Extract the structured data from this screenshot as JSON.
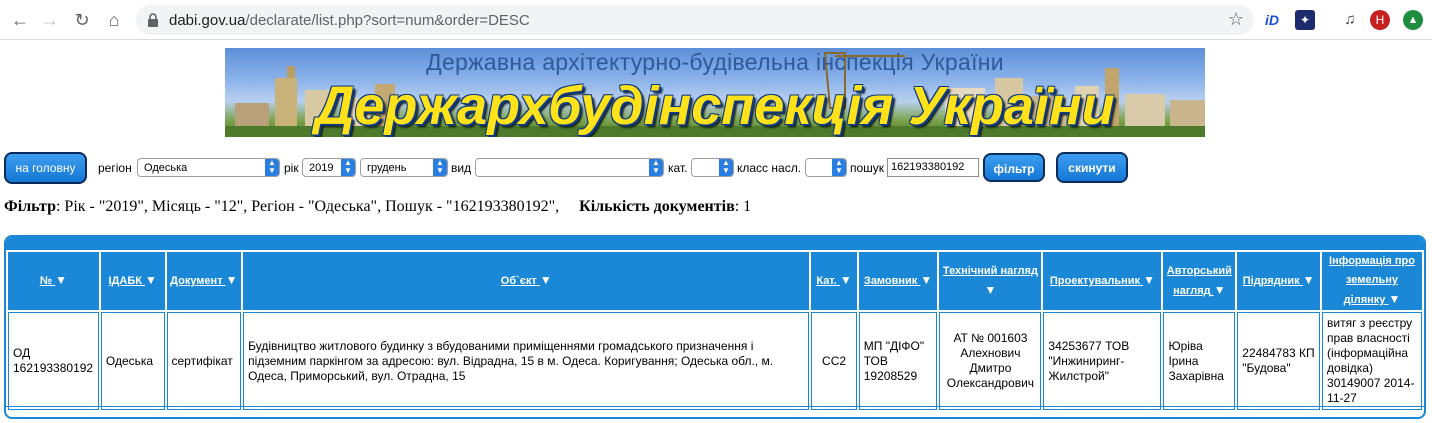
{
  "browser": {
    "url_host": "dabi.gov.ua",
    "url_path": "/declarate/list.php?sort=num&order=DESC",
    "avatar_letter": "Н",
    "ext_id_label": "iD"
  },
  "banner": {
    "subtitle": "Державна архітектурно-будівельна інспекція України",
    "title": "Держархбудінспекція України"
  },
  "filters": {
    "home_button": "на головну",
    "region_label": "регіон",
    "region_value": "Одеська",
    "year_label": "рік",
    "year_value": "2019",
    "month_value": "грудень",
    "type_label": "вид",
    "type_value": "",
    "cat_label": "кат.",
    "cat_value": "",
    "class_label": "класс насл.",
    "class_value": "",
    "search_label": "пошук",
    "search_value": "162193380192",
    "filter_button": "фільтр",
    "reset_button": "скинути"
  },
  "summary": {
    "filter_label": "Фільтр",
    "filter_text": ": Рік - \"2019\", Місяць - \"12\", Регіон - \"Одеська\", Пошук - \"162193380192\",",
    "count_label": "Кількість документів",
    "count_text": ": 1"
  },
  "table": {
    "headers": [
      "№",
      "ІДАБК",
      "Документ",
      "Об`єкт",
      "Кат.",
      "Замовник",
      "Технічний нагляд",
      "Проектувальник",
      "Авторський нагляд",
      "Підрядник",
      "Інформація про земельну ділянку"
    ],
    "rows": [
      {
        "num": "ОД 162193380192",
        "idabk": "Одеська",
        "document": "сертифікат",
        "object": "Будівництво житлового будинку з вбудованими приміщеннями громадського призначення і підземним паркінгом за адресою: вул. Відрадна, 15 в м. Одеса. Коригування; Одеська обл., м. Одеса, Приморський, вул. Отрадна, 15",
        "cat": "СС2",
        "customer": "МП \"ДІФО\" ТОВ 19208529",
        "tech_supervision": "АТ № 001603 Алехнович Дмитро Олександрович",
        "designer": "34253677 ТОВ \"Инжиниринг-Жилстрой\"",
        "author_supervision": "Юріва Ірина Захарівна",
        "contractor": "22484783 КП \"Будова\"",
        "land_info": "витяг з реєстру прав власності (інформаційна довідка) 30149007 2014-11-27"
      }
    ]
  }
}
